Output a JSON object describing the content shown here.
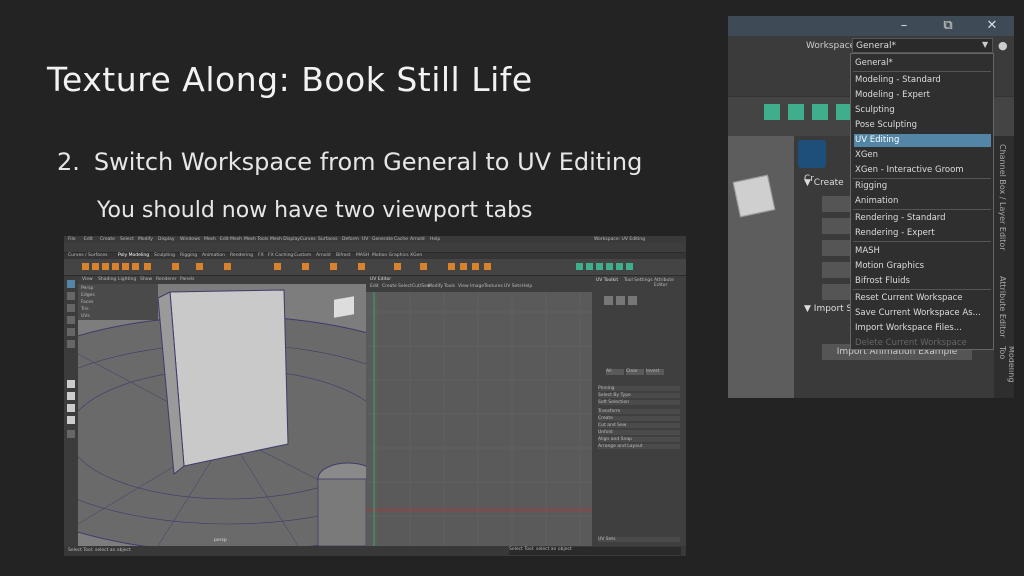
{
  "slide": {
    "title": "Texture Along: Book Still Life",
    "step_number": "2.",
    "step_text": "Switch Workspace from General to UV Editing",
    "note": "You should now have two viewport tabs"
  },
  "workspace_crop": {
    "window_controls": [
      "–",
      "⧉",
      "✕"
    ],
    "workspace_label": "Workspace:",
    "workspace_value": "General*",
    "create_label": "Create",
    "import_label": "Import S",
    "import_animation": "Import Animation Example",
    "panel_head": "Cr",
    "side_tabs": [
      "Channel Box / Layer Editor",
      "Attribute Editor",
      "Modeling Too"
    ],
    "menu_items": [
      {
        "label": "General*",
        "selected": false,
        "dimmed": false
      },
      {
        "label": "Modeling - Standard",
        "selected": false,
        "dimmed": false
      },
      {
        "label": "Modeling - Expert",
        "selected": false,
        "dimmed": false
      },
      {
        "label": "Sculpting",
        "selected": false,
        "dimmed": false
      },
      {
        "label": "Pose Sculpting",
        "selected": false,
        "dimmed": false
      },
      {
        "label": "UV Editing",
        "selected": true,
        "dimmed": false
      },
      {
        "label": "XGen",
        "selected": false,
        "dimmed": false
      },
      {
        "label": "XGen - Interactive Groom",
        "selected": false,
        "dimmed": false
      },
      {
        "label": "Rigging",
        "selected": false,
        "dimmed": false
      },
      {
        "label": "Animation",
        "selected": false,
        "dimmed": false
      },
      {
        "label": "Rendering - Standard",
        "selected": false,
        "dimmed": false
      },
      {
        "label": "Rendering - Expert",
        "selected": false,
        "dimmed": false
      },
      {
        "label": "MASH",
        "selected": false,
        "dimmed": false
      },
      {
        "label": "Motion Graphics",
        "selected": false,
        "dimmed": false
      },
      {
        "label": "Bifrost Fluids",
        "selected": false,
        "dimmed": false
      },
      {
        "label": "Reset Current Workspace",
        "selected": false,
        "dimmed": false
      },
      {
        "label": "Save Current Workspace As...",
        "selected": false,
        "dimmed": false
      },
      {
        "label": "Import Workspace Files...",
        "selected": false,
        "dimmed": false
      },
      {
        "label": "Delete Current Workspace",
        "selected": false,
        "dimmed": true
      }
    ]
  },
  "maya": {
    "menubar": [
      "File",
      "Edit",
      "Create",
      "Select",
      "Modify",
      "Display",
      "Windows",
      "Mesh",
      "Edit Mesh",
      "Mesh Tools",
      "Mesh Display",
      "Curves",
      "Surfaces",
      "Deform",
      "UV",
      "Generate",
      "Cache",
      "Arnold",
      "Help"
    ],
    "workspace": "Workspace: UV Editing",
    "shelf_tabs": [
      "Curves / Surfaces",
      "Poly Modeling",
      "Sculpting",
      "Rigging",
      "Animation",
      "Rendering",
      "FX",
      "FX Caching",
      "Custom",
      "Arnold",
      "Bifrost",
      "MASH",
      "Motion Graphics",
      "XGen"
    ],
    "viewport_menu": [
      "View",
      "Shading",
      "Lighting",
      "Show",
      "Renderer",
      "Panels"
    ],
    "outliner_rows": [
      "Persp",
      "Edges",
      "Faces",
      "Tris",
      "UVs"
    ],
    "uv_editor_title": "UV Editor",
    "uv_menu": [
      "Edit",
      "Create",
      "Select",
      "Cut/Sew",
      "Modify",
      "Tools",
      "View",
      "Image",
      "Textures",
      "UV Sets",
      "Help"
    ],
    "uv_toolkit_title": "UV Toolkit",
    "uv_toolkit_tabs": [
      "Tool Settings",
      "Attribute Editor"
    ],
    "uv_toolkit_rows": [
      "Pinning",
      "Select By Type",
      "Soft Selection",
      "Transform",
      "Create",
      "Cut and Sew",
      "Unfold",
      "Align and Snap",
      "Arrange and Layout"
    ],
    "uv_toolkit_buttons": [
      "All",
      "Clear",
      "Invert"
    ],
    "uv_sets_label": "UV Sets",
    "status_left": "Select Tool: select an object",
    "status_right": "Select Tool: select an object",
    "frame_label": "persp"
  },
  "colors": {
    "background": "#232323",
    "accent_selected": "#5285a6",
    "shelf_icon": "#3fae8c"
  }
}
